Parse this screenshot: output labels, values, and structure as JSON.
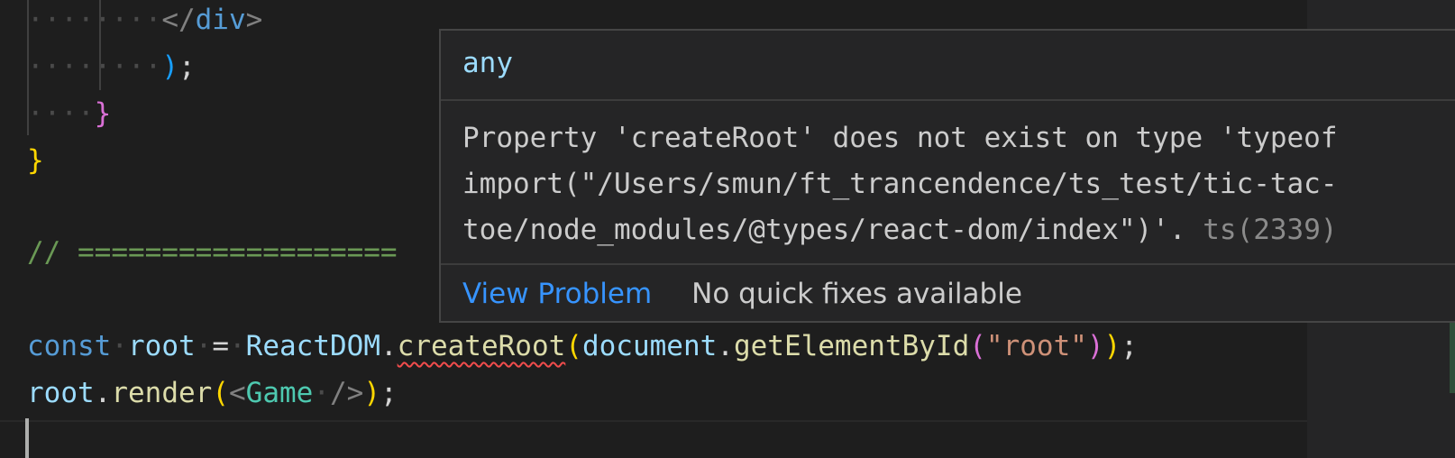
{
  "editor": {
    "lines": {
      "l1": {
        "ws": "········",
        "open": "</",
        "tag": "div",
        "close": ">"
      },
      "l2": {
        "ws": "········",
        "paren": ")",
        "semi": ";"
      },
      "l3": {
        "ws": "····",
        "brace": "}"
      },
      "l4": {
        "brace": "}"
      },
      "l5": {
        "comment": "// ==================="
      },
      "l6": {
        "kw": "const",
        "var": "root",
        "op": "=",
        "obj": "ReactDOM",
        "dot": ".",
        "method": "createRoot",
        "p1": "(",
        "doc": "document",
        "dot2": ".",
        "fn": "getElementById",
        "p2": "(",
        "str": "\"root\"",
        "p3": ")",
        "p4": ")",
        "semi": ";"
      },
      "l7": {
        "var": "root",
        "dot": ".",
        "fn": "render",
        "p1": "(",
        "lt": "<",
        "cls": "Game",
        "ws": "·",
        "end": "/>",
        "p2": ")",
        "semi": ";"
      }
    }
  },
  "hover": {
    "type": "any",
    "message_line1": "Property 'createRoot' does not exist on type 'typeof",
    "message_line2": "import(\"/Users/smun/ft_trancendence/ts_test/tic-tac-",
    "message_line3": "toe/node_modules/@types/react-dom/index\")'.",
    "error_code": "ts(2339)",
    "view_problem": "View Problem",
    "no_quick_fixes": "No quick fixes available"
  },
  "colors": {
    "background": "#1e1e1e",
    "error_squiggle": "#f14c4c",
    "link": "#3794ff"
  }
}
